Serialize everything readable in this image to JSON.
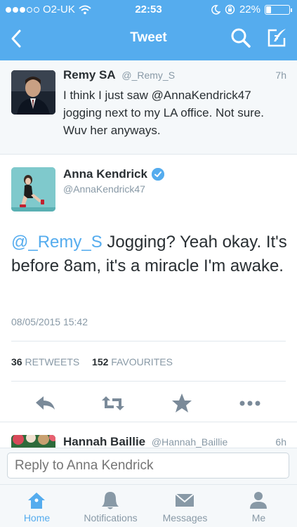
{
  "status_bar": {
    "carrier": "O2-UK",
    "time": "22:53",
    "battery": "22%",
    "signal_bars_filled": 3,
    "signal_bars_total": 5,
    "battery_level": 0.22
  },
  "nav": {
    "title": "Tweet"
  },
  "reply_tweet": {
    "name": "Remy SA",
    "handle": "@_Remy_S",
    "time": "7h",
    "text": "I think I just saw @AnnaKendrick47 jogging next to my LA office. Not sure. Wuv her anyways."
  },
  "main_tweet": {
    "name": "Anna Kendrick",
    "handle": "@AnnaKendrick47",
    "mention": "@_Remy_S",
    "text": " Jogging? Yeah okay. It's before 8am, it's a miracle I'm awake.",
    "date": "08/05/2015 15:42",
    "retweets_count": "36",
    "retweets_label": "RETWEETS",
    "favourites_count": "152",
    "favourites_label": "FAVOURITES"
  },
  "next_tweet": {
    "name": "Hannah Baillie",
    "handle": "@Hannah_Baillie",
    "time": "6h"
  },
  "reply_bar": {
    "placeholder": "Reply to Anna Kendrick"
  },
  "tabs": [
    {
      "label": "Home",
      "icon": "home-icon",
      "active": true
    },
    {
      "label": "Notifications",
      "icon": "bell-icon",
      "active": false
    },
    {
      "label": "Messages",
      "icon": "envelope-icon",
      "active": false
    },
    {
      "label": "Me",
      "icon": "person-icon",
      "active": false
    }
  ],
  "colors": {
    "accent": "#55acee",
    "text": "#292f33",
    "muted": "#8899a6",
    "icon_gray": "#8899a6",
    "star_gray": "#7a8a99"
  }
}
